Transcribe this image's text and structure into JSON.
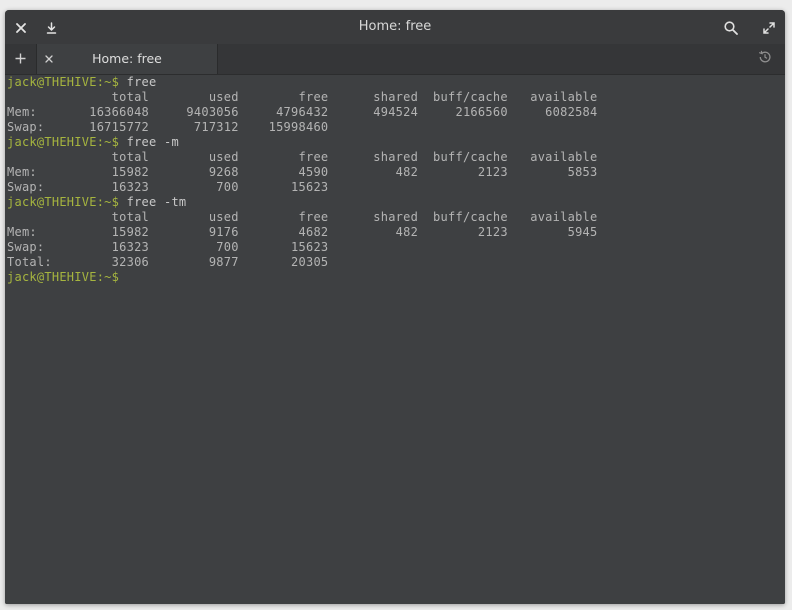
{
  "window": {
    "title": "Home: free"
  },
  "tabs": [
    {
      "label": "Home: free"
    }
  ],
  "terminal": {
    "lines": [
      {
        "prompt": "jack@THEHIVE:~$",
        "cmd": " free"
      },
      {
        "out": "              total        used        free      shared  buff/cache   available"
      },
      {
        "out": "Mem:       16366048     9403056     4796432      494524     2166560     6082584"
      },
      {
        "out": "Swap:      16715772      717312    15998460"
      },
      {
        "prompt": "jack@THEHIVE:~$",
        "cmd": " free -m"
      },
      {
        "out": "              total        used        free      shared  buff/cache   available"
      },
      {
        "out": "Mem:          15982        9268        4590         482        2123        5853"
      },
      {
        "out": "Swap:         16323         700       15623"
      },
      {
        "prompt": "jack@THEHIVE:~$",
        "cmd": " free -tm"
      },
      {
        "out": "              total        used        free      shared  buff/cache   available"
      },
      {
        "out": "Mem:          15982        9176        4682         482        2123        5945"
      },
      {
        "out": "Swap:         16323         700       15623"
      },
      {
        "out": "Total:        32306        9877       20305"
      },
      {
        "prompt": "jack@THEHIVE:~$",
        "cmd": ""
      }
    ]
  },
  "icons": {
    "close": "close-icon",
    "download": "download-icon",
    "search": "search-icon",
    "fullscreen": "fullscreen-icon",
    "new_tab": "plus-icon",
    "tab_close": "close-icon",
    "history": "history-icon"
  },
  "colors": {
    "background": "#3e4042",
    "prompt": "#a6b53f",
    "text": "#b4b4b4"
  }
}
